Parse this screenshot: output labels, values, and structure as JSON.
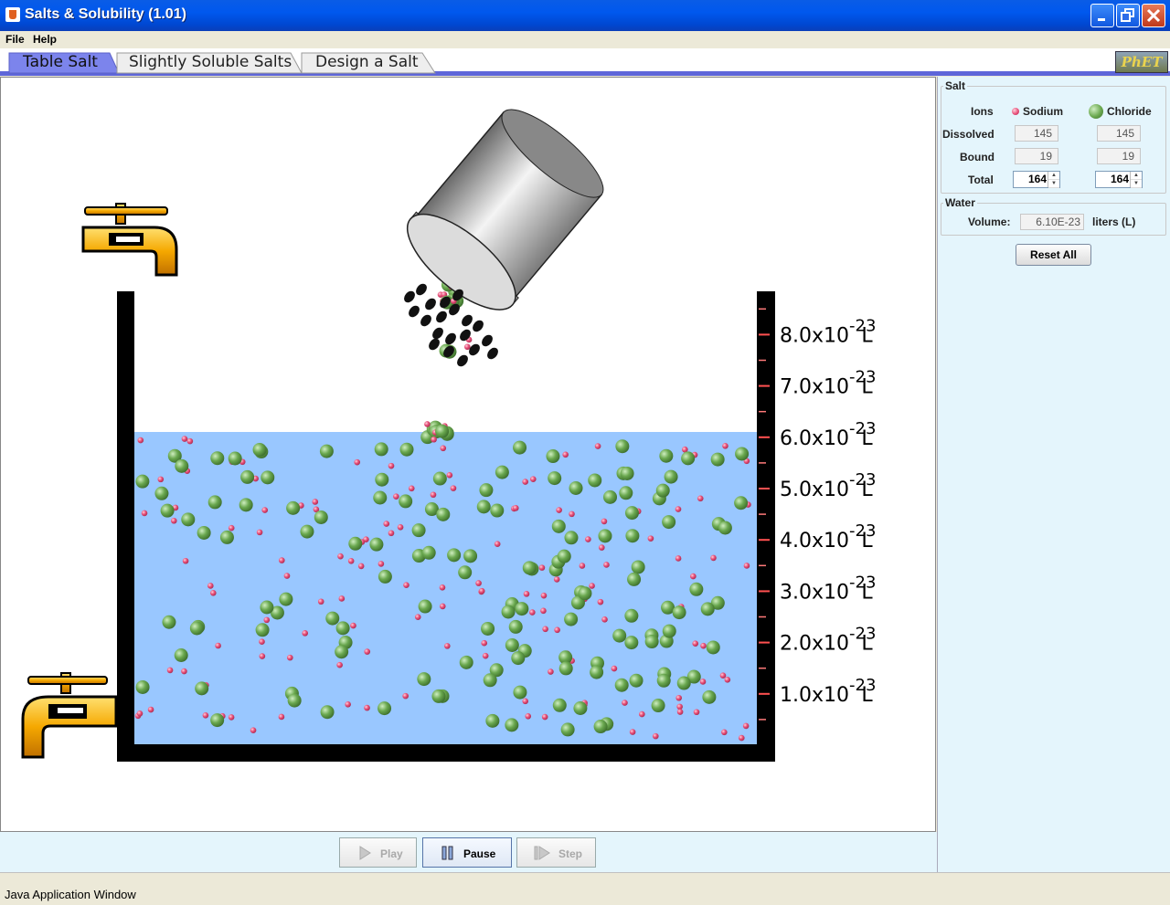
{
  "window": {
    "title": "Salts & Solubility (1.01)"
  },
  "menu": {
    "items": [
      "File",
      "Help"
    ]
  },
  "tabs": [
    {
      "label": "Table Salt",
      "selected": true
    },
    {
      "label": "Slightly Soluble Salts",
      "selected": false
    },
    {
      "label": "Design a Salt",
      "selected": false
    }
  ],
  "logo": {
    "text": "PhET"
  },
  "beaker": {
    "ticks": [
      {
        "value": "8.0x10",
        "exp": "-23",
        "unit": "L"
      },
      {
        "value": "7.0x10",
        "exp": "-23",
        "unit": "L"
      },
      {
        "value": "6.0x10",
        "exp": "-23",
        "unit": "L"
      },
      {
        "value": "5.0x10",
        "exp": "-23",
        "unit": "L"
      },
      {
        "value": "4.0x10",
        "exp": "-23",
        "unit": "L"
      },
      {
        "value": "3.0x10",
        "exp": "-23",
        "unit": "L"
      },
      {
        "value": "2.0x10",
        "exp": "-23",
        "unit": "L"
      },
      {
        "value": "1.0x10",
        "exp": "-23",
        "unit": "L"
      }
    ],
    "water_level_liters": 6.1e-23,
    "water_color": "#99c7ff"
  },
  "ion_colors": {
    "sodium": "#e8507a",
    "chloride": "#5f9f4a"
  },
  "controls": {
    "play": "Play",
    "pause": "Pause",
    "step": "Step"
  },
  "salt_panel": {
    "title": "Salt",
    "ions_label": "Ions",
    "sodium_label": "Sodium",
    "chloride_label": "Chloride",
    "dissolved_label": "Dissolved",
    "bound_label": "Bound",
    "total_label": "Total",
    "sodium": {
      "dissolved": "145",
      "bound": "19",
      "total": "164"
    },
    "chloride": {
      "dissolved": "145",
      "bound": "19",
      "total": "164"
    }
  },
  "water_panel": {
    "title": "Water",
    "volume_label": "Volume:",
    "volume_value": "6.10E-23",
    "volume_unit": "liters (L)"
  },
  "reset_label": "Reset All",
  "status": {
    "text": "Java Application Window"
  }
}
